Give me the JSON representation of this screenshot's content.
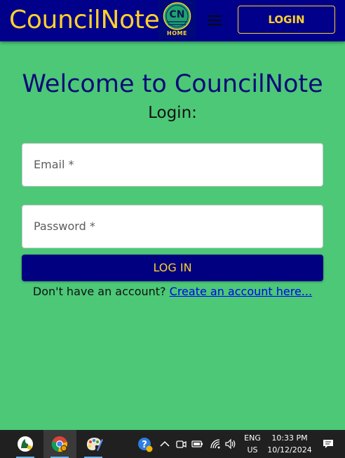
{
  "header": {
    "brand": "CouncilNote",
    "home_logo_monogram": "CN",
    "home_logo_label": "HOME",
    "login_button": "LOGIN"
  },
  "main": {
    "welcome": "Welcome to CouncilNote",
    "login_heading": "Login:",
    "email_placeholder": "Email *",
    "password_placeholder": "Password *",
    "submit": "LOG IN",
    "signup_prompt": "Don't have an account?",
    "signup_link": "Create an account here..."
  },
  "taskbar": {
    "apps": [
      {
        "name": "cat-app-icon"
      },
      {
        "name": "chrome-icon"
      },
      {
        "name": "paint-icon"
      }
    ],
    "tray": {
      "language_top": "ENG",
      "language_bottom": "US",
      "time": "10:33 PM",
      "date": "10/12/2024"
    }
  },
  "colors": {
    "page_bg": "#4cc877",
    "header_bg": "#00008b",
    "accent_gold": "#ffd12b",
    "heading_navy": "#0a0a78",
    "button_navy": "#000080",
    "link_blue": "#0000ee",
    "taskbar_bg": "#202020"
  }
}
